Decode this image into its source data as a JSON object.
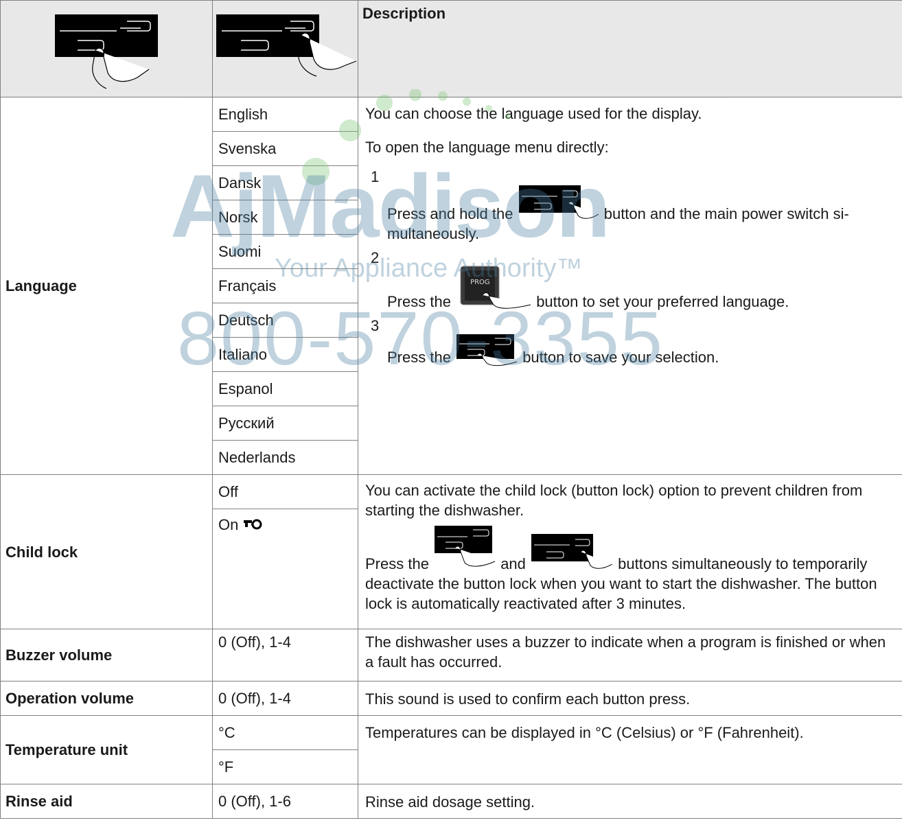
{
  "header": {
    "description": "Description"
  },
  "rows": {
    "language": {
      "label": "Language",
      "options": [
        "English",
        "Svenska",
        "Dansk",
        "Norsk",
        "Suomi",
        "Français",
        "Deutsch",
        "Italiano",
        "Espanol",
        "Русский",
        "Nederlands"
      ],
      "desc_line1": "You can choose the language used for the display.",
      "desc_line2": "To open the language menu directly:",
      "step1_num": "1",
      "step1_a": "Press and hold the",
      "step1_b": "button and the main power switch si-multaneously.",
      "step2_num": "2",
      "step2_a": "Press the",
      "step2_b": "button to set your preferred language.",
      "step3_num": "3",
      "step3_a": "Press the",
      "step3_b": "button to save your selection.",
      "prog_label": "PROG"
    },
    "child_lock": {
      "label": "Child lock",
      "opt_off": "Off",
      "opt_on": "On",
      "desc1": "You can activate the child lock (button lock) option to prevent children from starting the dishwasher.",
      "desc2_a": "Press the",
      "desc2_b": "and",
      "desc2_c": "buttons simultaneously to temporarily deactivate the button lock when you want to start the dishwasher. The button lock is automatically reactivated after 3 minutes."
    },
    "buzzer": {
      "label": "Buzzer volume",
      "option": "0 (Off), 1-4",
      "desc": "The dishwasher uses a buzzer to indicate when a program is finished or when a fault has occurred."
    },
    "operation": {
      "label": "Operation volume",
      "option": "0 (Off), 1-4",
      "desc": "This sound is used to confirm each button press."
    },
    "temperature": {
      "label": "Temperature unit",
      "opt_c": "°C",
      "opt_f": "°F",
      "desc": "Temperatures can be displayed in °C (Celsius) or °F (Fahrenheit)."
    },
    "rinse": {
      "label": "Rinse aid",
      "option": "0 (Off), 1-6",
      "desc": "Rinse aid dosage setting."
    }
  },
  "watermark": {
    "brand": "AjMadison",
    "tagline": "Your Appliance Authority™",
    "phone": "800-570-3355"
  },
  "icons": {
    "lock": "key-icon",
    "button": "touch-button-icon"
  }
}
